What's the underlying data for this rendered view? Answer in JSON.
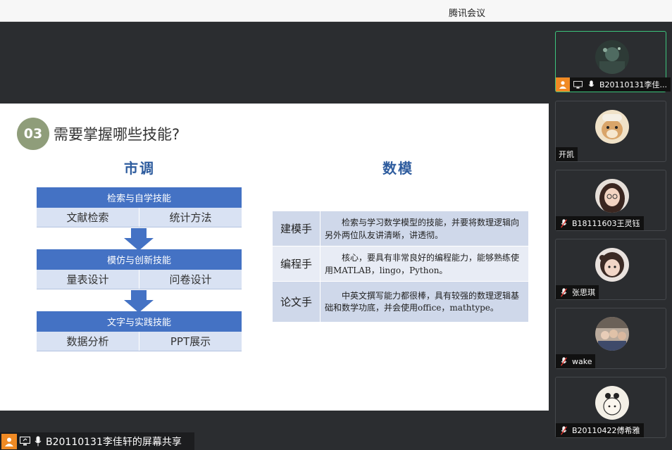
{
  "window": {
    "title": "腾讯会议"
  },
  "slide": {
    "number": "03",
    "heading": "需要掌握哪些技能?",
    "left_title": "市调",
    "right_title": "数模",
    "flow": [
      {
        "head": "检索与自学技能",
        "cells": [
          "文献检索",
          "统计方法"
        ]
      },
      {
        "head": "模仿与创新技能",
        "cells": [
          "量表设计",
          "问卷设计"
        ]
      },
      {
        "head": "文字与实践技能",
        "cells": [
          "数据分析",
          "PPT展示"
        ]
      }
    ],
    "table": [
      {
        "role": "建模手",
        "desc": "检索与学习数学模型的技能，并要将数理逻辑向另外两位队友讲清晰，讲透彻。"
      },
      {
        "role": "编程手",
        "desc": "核心，要具有非常良好的编程能力，能够熟练使用MATLAB，lingo，Python。"
      },
      {
        "role": "论文手",
        "desc": "中英文撰写能力都很棒，具有较强的数理逻辑基础和数学功底，并会使用office，mathtype。"
      }
    ]
  },
  "share_bar": {
    "label": "B20110131李佳轩的屏幕共享"
  },
  "participants": [
    {
      "name": "B20110131李佳...",
      "active": true,
      "host": true
    },
    {
      "name": "开凯",
      "active": false,
      "host": false
    },
    {
      "name": "B18111603王灵钰",
      "active": false,
      "host": false
    },
    {
      "name": "张思琪",
      "active": false,
      "host": false
    },
    {
      "name": "wake",
      "active": false,
      "host": false
    },
    {
      "name": "B20110422傅希雅",
      "active": false,
      "host": false
    }
  ],
  "colors": {
    "accent_green": "#3cc47c",
    "host_orange": "#f08a24",
    "slide_blue": "#4472c4",
    "muted_red": "#e0342e"
  }
}
